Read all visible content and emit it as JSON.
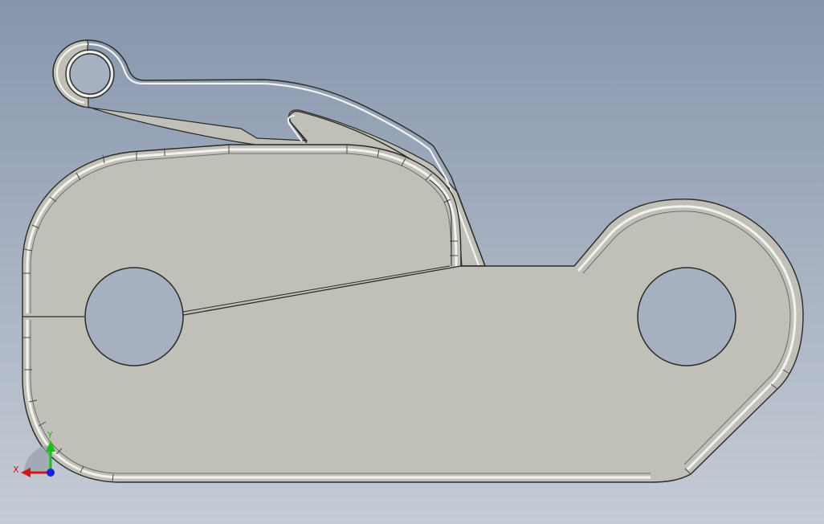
{
  "viewport": {
    "background_top": "#8796ad",
    "background_bottom": "#c6ccd6",
    "part_fill": "#c0c0b8",
    "part_edge": "#2a2a26",
    "bevel_light": "#f2f2ee",
    "bevel_dark": "#6e6e66",
    "hole_fill": "#a6b0c1"
  },
  "triad": {
    "x_label": "X",
    "y_label": "Y",
    "x_color": "#d01818",
    "y_color": "#18c018",
    "z_color": "#1820d8"
  }
}
